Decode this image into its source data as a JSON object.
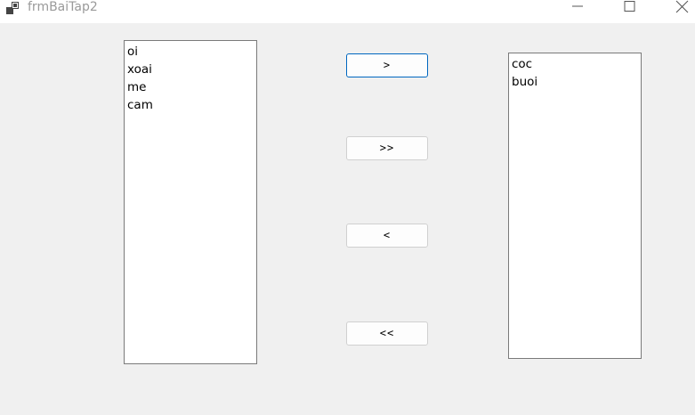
{
  "window": {
    "title": "frmBaiTap2"
  },
  "title_bar_icons": {
    "app": "app-window-icon",
    "minimize": "minimize-icon",
    "maximize": "maximize-icon",
    "close": "close-icon"
  },
  "left_list": {
    "items": [
      "oi",
      "xoai",
      "me",
      "cam"
    ]
  },
  "right_list": {
    "items": [
      "coc",
      "buoi"
    ]
  },
  "buttons": {
    "move_one_right": "> ",
    "move_all_right": ">>",
    "move_one_left": "<",
    "move_all_left": "<<"
  },
  "colors": {
    "client_background": "#f0f0f0",
    "focus_border": "#0067c0",
    "title_text": "#9a9a9a"
  }
}
